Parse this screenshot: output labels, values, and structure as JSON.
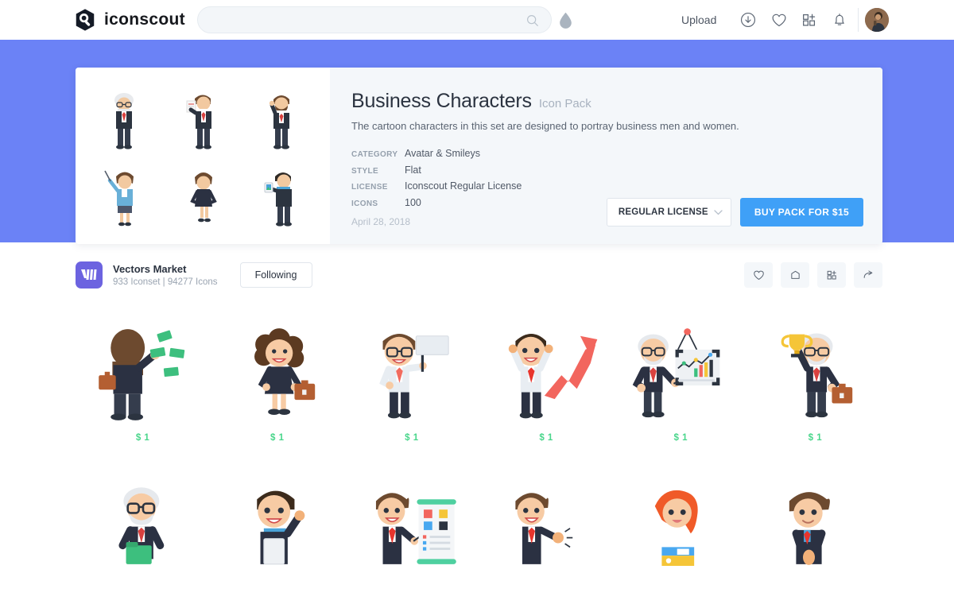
{
  "header": {
    "logo_text": "iconscout",
    "logo_icon": "iconscout-hexagon-logo",
    "search_placeholder": "",
    "search_value": "",
    "search_icon": "search-icon",
    "droplet_icon": "droplet-icon",
    "upload_label": "Upload",
    "icons": [
      {
        "name": "download-circle-icon"
      },
      {
        "name": "heart-icon"
      },
      {
        "name": "grid-plus-icon"
      },
      {
        "name": "bell-icon"
      }
    ],
    "avatar_label": "user-avatar"
  },
  "pack": {
    "title": "Business Characters",
    "kind": "Icon Pack",
    "description": "The cartoon characters in this set are designed to portray business men and women.",
    "meta": [
      {
        "key": "CATEGORY",
        "value": "Avatar & Smileys"
      },
      {
        "key": "STYLE",
        "value": "Flat"
      },
      {
        "key": "LICENSE",
        "value": "Iconscout Regular License"
      },
      {
        "key": "ICONS",
        "value": "100"
      }
    ],
    "date": "April 28, 2018",
    "license_select_value": "REGULAR LICENSE",
    "buy_label": "BUY PACK FOR $15",
    "previews": [
      {
        "name": "preview-old-man-glasses"
      },
      {
        "name": "preview-man-holding-paper"
      },
      {
        "name": "preview-bearded-man-thumbs-up"
      },
      {
        "name": "preview-woman-pointer-stick"
      },
      {
        "name": "preview-woman-hands-on-hips"
      },
      {
        "name": "preview-man-holding-tablet"
      }
    ]
  },
  "author": {
    "name": "Vectors Market",
    "stats": "933 Iconset | 94277 Icons",
    "follow_label": "Following",
    "avatar_icon": "vectors-market-logo",
    "actions": [
      {
        "name": "like-icon"
      },
      {
        "name": "bag-icon"
      },
      {
        "name": "add-to-collection-icon"
      },
      {
        "name": "share-icon"
      }
    ]
  },
  "grid": {
    "items": [
      {
        "name": "icon-man-throwing-money",
        "price": "$ 1"
      },
      {
        "name": "icon-curly-hair-businesswoman",
        "price": "$ 1"
      },
      {
        "name": "icon-man-holding-blank-sign",
        "price": "$ 1"
      },
      {
        "name": "icon-man-cheering-with-arrow",
        "price": "$ 1"
      },
      {
        "name": "icon-old-man-presenting-chart",
        "price": "$ 1"
      },
      {
        "name": "icon-old-man-holding-trophy",
        "price": "$ 1"
      },
      {
        "name": "icon-old-man-holding-folder",
        "price": ""
      },
      {
        "name": "icon-man-waving-with-clipboard",
        "price": ""
      },
      {
        "name": "icon-man-presenting-board",
        "price": ""
      },
      {
        "name": "icon-man-waving-hand",
        "price": ""
      },
      {
        "name": "icon-redhead-woman-with-files",
        "price": ""
      },
      {
        "name": "icon-man-hands-together",
        "price": ""
      }
    ]
  },
  "colors": {
    "hero_banner": "#6b82f6",
    "buy_button": "#3fa0f7",
    "price_green": "#49d68b",
    "author_avatar": "#6c63e0",
    "info_panel": "#f4f7fa"
  }
}
